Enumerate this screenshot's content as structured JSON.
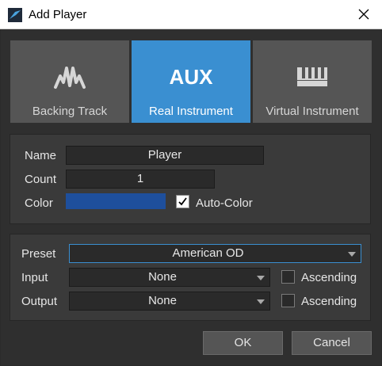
{
  "window": {
    "title": "Add Player",
    "accent": "#3a8fd1"
  },
  "tabs": [
    {
      "label": "Backing Track",
      "icon": "waveform-icon",
      "active": false
    },
    {
      "label": "Real Instrument",
      "icon_text": "AUX",
      "active": true
    },
    {
      "label": "Virtual Instrument",
      "icon": "piano-keys-icon",
      "active": false
    }
  ],
  "player": {
    "name_label": "Name",
    "name_value": "Player",
    "count_label": "Count",
    "count_value": "1",
    "color_label": "Color",
    "color_value": "#1e4f9c",
    "auto_color_label": "Auto-Color",
    "auto_color_checked": true
  },
  "routing": {
    "preset_label": "Preset",
    "preset_value": "American OD",
    "input_label": "Input",
    "input_value": "None",
    "input_ascending_label": "Ascending",
    "input_ascending_checked": false,
    "output_label": "Output",
    "output_value": "None",
    "output_ascending_label": "Ascending",
    "output_ascending_checked": false
  },
  "buttons": {
    "ok": "OK",
    "cancel": "Cancel"
  }
}
